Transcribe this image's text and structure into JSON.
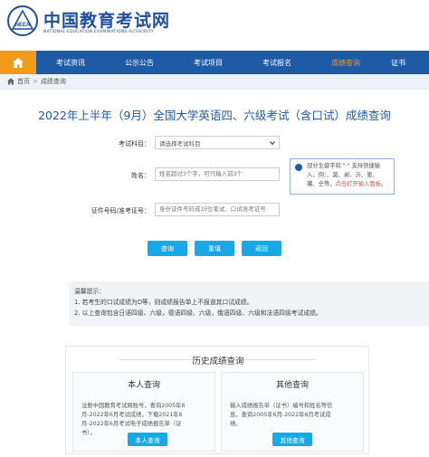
{
  "header": {
    "logo_text": "NEEA",
    "title": "中国教育考试网",
    "subtitle": "NATIONAL EDUCATION EXAMINATIONS AUTHORITY"
  },
  "nav": {
    "items": [
      {
        "label": "考试资讯",
        "active": false
      },
      {
        "label": "公示公告",
        "active": false
      },
      {
        "label": "考试项目",
        "active": false
      },
      {
        "label": "考试报名",
        "active": false
      },
      {
        "label": "成绩查询",
        "active": true
      },
      {
        "label": "证书",
        "active": false
      }
    ]
  },
  "breadcrumb": {
    "home": "首页",
    "separator": ">",
    "current": "成绩查询"
  },
  "page_title": "2022年上半年（9月）全国大学英语四、六级考试（含口试）成绩查询",
  "form": {
    "subject_label": "考试科目：",
    "subject_value": "请选择考试科目",
    "name_label": "姓名：",
    "name_placeholder": "姓名超过3个字，可只输入前3个",
    "id_label": "证件号码/准考证号：",
    "id_placeholder": "身份证件号码或15位笔试、口试准考证号",
    "tip_line1": "部分生僻字和 \"·\" 支持快捷输",
    "tip_line2": "入，例：、莫、昶、沂、恵、",
    "tip_line3_a": "瓘、仝等，",
    "tip_line3_link": "点击打开输入面板",
    "tip_line3_b": "。"
  },
  "buttons": {
    "query": "查询",
    "reset": "重填",
    "back": "返回"
  },
  "notice": {
    "title": "温馨提示：",
    "line1": "1. 若考生的口试成绩为D等，则成绩报告单上不报道其口试成绩。",
    "line2": "2. 以上查询包含日语四级、六级，德语四级、六级，俄语四级、六级和法语四级考试成绩。"
  },
  "history": {
    "title": "历史成绩查询",
    "self": {
      "title": "本人查询",
      "line1": "注册中国教育考试网账号，查询2005年6",
      "line2": "月-2022年6月考试成绩，下载2021年6",
      "line3": "月-2022年6月考试电子成绩报告单（证",
      "line4": "书）。",
      "button": "本人查询"
    },
    "other": {
      "title": "其他查询",
      "line1": "输入成绩报告单（证书）编号和姓名等信",
      "line2": "息，查询2005年6月-2022年6月考试成",
      "line3": "绩。",
      "button": "其他查询"
    }
  },
  "colors": {
    "brand": "#1f5aa6",
    "accent": "#f39a1a",
    "button": "#18a8e6"
  }
}
